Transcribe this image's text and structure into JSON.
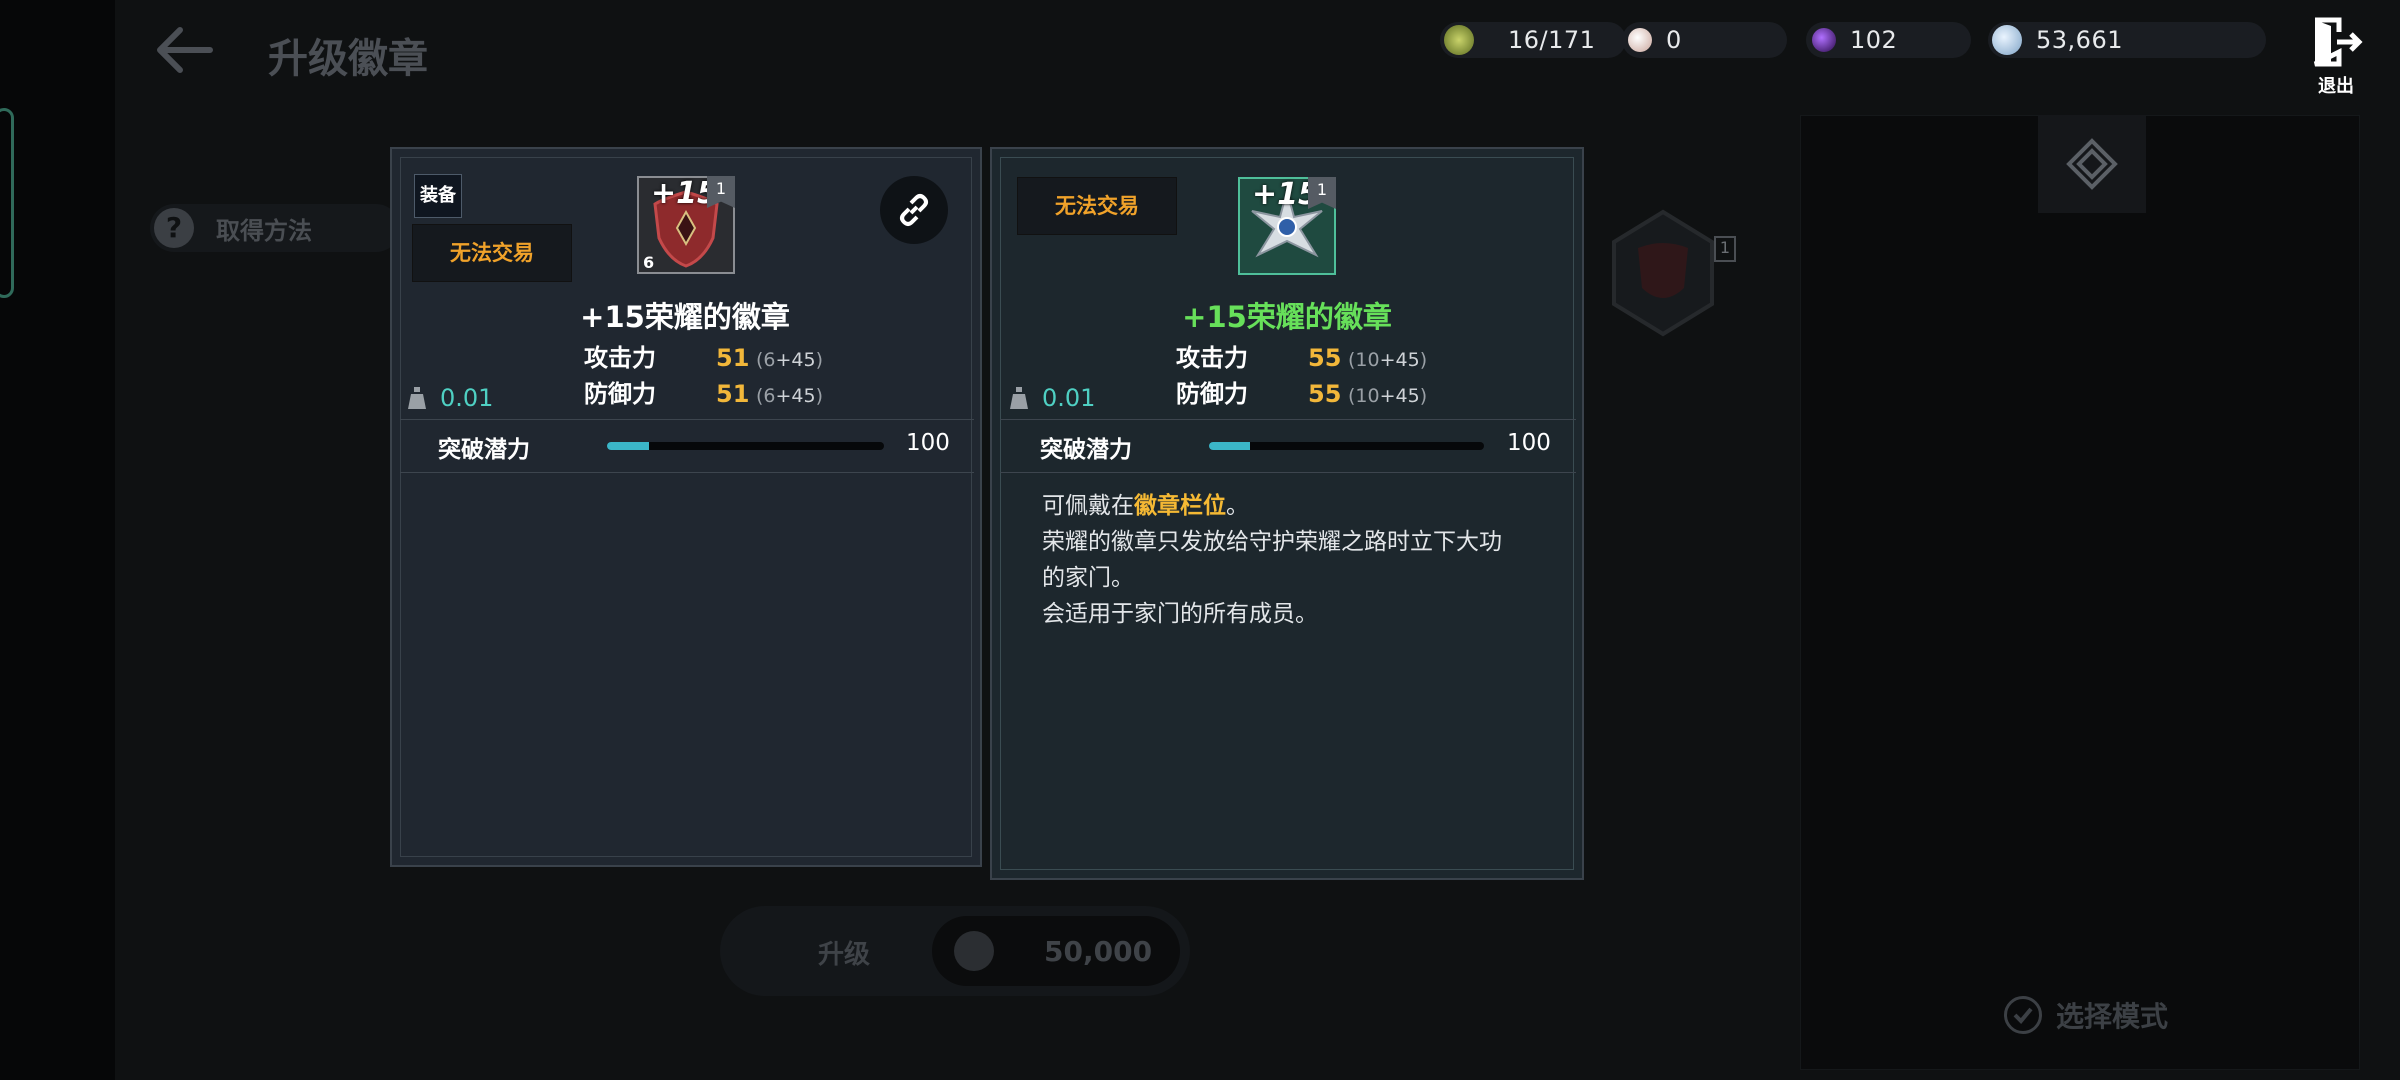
{
  "header": {
    "title": "升级徽章",
    "currencies": [
      {
        "icon": "energy-gem-icon",
        "value": "16/171",
        "color": "#8a9a3a"
      },
      {
        "icon": "pearl-icon",
        "value": "0",
        "color": "#d9b8b0"
      },
      {
        "icon": "dark-orb-icon",
        "value": "102",
        "color": "#5a2a8a"
      },
      {
        "icon": "silver-coin-icon",
        "value": "53,661",
        "color": "#b9d3ea"
      }
    ],
    "exit_label": "退出"
  },
  "howto_label": "取得方法",
  "upgrade": {
    "label": "升级",
    "cost": "50,000"
  },
  "select_mode_label": "选择模式",
  "left_card": {
    "equip_tag": "装备",
    "trade_tag": "无法交易",
    "slot_level": "+15",
    "slot_tier": "1",
    "slot_count": "6",
    "name": "+15荣耀的徽章",
    "name_color": "#ffffff",
    "stats": [
      {
        "label": "攻击力",
        "value": "51",
        "base": "6",
        "bonus": "+45"
      },
      {
        "label": "防御力",
        "value": "51",
        "base": "6",
        "bonus": "+45"
      }
    ],
    "weight": "0.01",
    "potential_label": "突破潜力",
    "potential_value": "100",
    "potential_fill": 0.15
  },
  "right_card": {
    "trade_tag": "无法交易",
    "slot_level": "+15",
    "slot_tier": "1",
    "name": "+15荣耀的徽章",
    "name_color": "#67e05a",
    "stats": [
      {
        "label": "攻击力",
        "value": "55",
        "base": "10",
        "bonus": "+45"
      },
      {
        "label": "防御力",
        "value": "55",
        "base": "10",
        "bonus": "+45"
      }
    ],
    "weight": "0.01",
    "potential_label": "突破潜力",
    "potential_value": "100",
    "potential_fill": 0.15,
    "desc": {
      "line1_prefix": "可佩戴在",
      "line1_highlight": "徽章栏位",
      "line1_suffix": "。",
      "line2": "荣耀的徽章只发放给守护荣耀之路时立下大功",
      "line3": "的家门。",
      "line4": "会适用于家门的所有成员。"
    }
  }
}
